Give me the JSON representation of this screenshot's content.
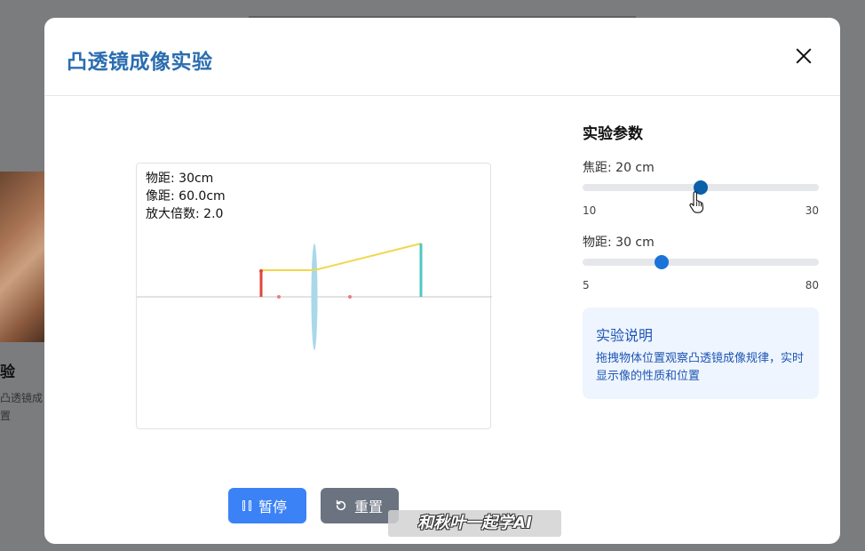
{
  "background": {
    "card_title": "验",
    "card_desc_line1": "凸透镜成",
    "card_desc_line2": "置"
  },
  "modal": {
    "title": "凸透镜成像实验",
    "close_icon": "close-icon"
  },
  "experiment": {
    "object_distance_text": "物距: 30cm",
    "image_distance_text": "像距: 60.0cm",
    "magnification_text": "放大倍数: 2.0",
    "colors": {
      "object": "#e0453a",
      "image": "#4fc7c4",
      "ray": "#f0d84a",
      "lens": "#a8d8ea",
      "focal_point": "#f07a7a",
      "axis": "#d0d0d0"
    }
  },
  "buttons": {
    "pause_label": "暂停",
    "reset_label": "重置",
    "pause_icon": "pause-icon",
    "reset_icon": "reset-icon"
  },
  "params": {
    "title": "实验参数",
    "focal": {
      "label": "焦距: 20 cm",
      "min": "10",
      "max": "30",
      "value": 20,
      "range": [
        10,
        30
      ],
      "thumb_color": "#0b5fa8"
    },
    "object": {
      "label": "物距: 30 cm",
      "min": "5",
      "max": "80",
      "value": 30,
      "range": [
        5,
        80
      ],
      "thumb_color": "#1a73d9"
    }
  },
  "help": {
    "title": "实验说明",
    "text": "拖拽物体位置观察凸透镜成像规律，实时显示像的性质和位置"
  },
  "watermark": "和秋叶一起学AI"
}
